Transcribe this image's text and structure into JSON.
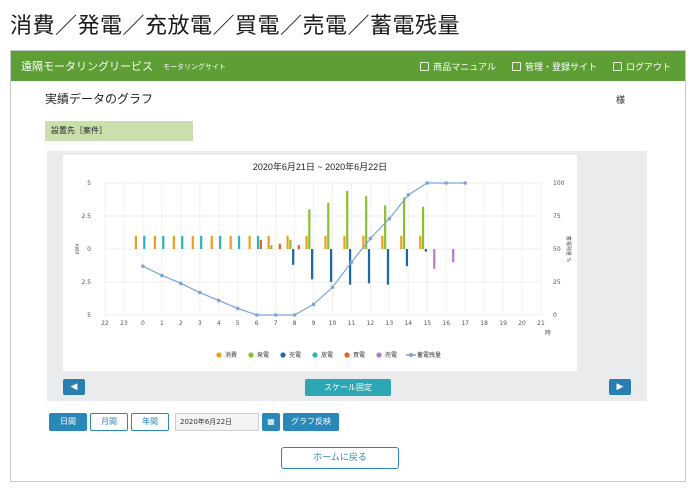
{
  "heading": "消費／発電／充放電／買電／売電／蓄電残量",
  "topbar": {
    "site_title": "遠隔モータリングリービス",
    "site_sub": "モータリングサイト",
    "nav": [
      "商品マニュアル",
      "管理・登録サイト",
      "ログアウト"
    ]
  },
  "section_title": "実績データのグラフ",
  "user_label": "様",
  "site_label": "設置先［案件］",
  "chart_data": {
    "type": "bar",
    "title": "2020年6月21日 ~ 2020年6月22日",
    "x": [
      "22",
      "23",
      "0",
      "1",
      "2",
      "3",
      "4",
      "5",
      "6",
      "7",
      "8",
      "9",
      "10",
      "11",
      "12",
      "13",
      "14",
      "15",
      "16",
      "17",
      "18",
      "19",
      "20",
      "21"
    ],
    "x_unit": "時",
    "y_left_ticks": [
      "5",
      "2.5",
      "0",
      "2.5",
      "5"
    ],
    "y_left_range": [
      -5,
      5
    ],
    "y_left_label": "kWh",
    "y_right_ticks": [
      "100",
      "75",
      "50",
      "25",
      "0"
    ],
    "y_right_range": [
      0,
      100
    ],
    "y_right_label": "蓄電残量 %",
    "series": [
      {
        "name": "消費",
        "color": "#e8a020",
        "values": [
          null,
          null,
          1,
          1,
          1,
          1,
          1,
          1,
          1,
          1,
          1,
          1,
          1,
          1,
          1,
          1,
          1,
          1,
          null,
          null,
          null,
          null,
          null,
          null
        ]
      },
      {
        "name": "発電",
        "color": "#8cbf2e",
        "values": [
          null,
          null,
          0,
          0,
          0,
          0,
          0,
          0,
          0,
          0.3,
          0.7,
          3,
          3.5,
          4.4,
          4,
          3.3,
          3.9,
          3.2,
          null,
          null,
          null,
          null,
          null,
          null
        ]
      },
      {
        "name": "充電",
        "color": "#1b6aa5",
        "values": [
          null,
          null,
          0,
          0,
          0,
          0,
          0,
          0,
          0,
          0,
          -1.2,
          -2.3,
          -2.5,
          -2.7,
          -2.6,
          -2.7,
          -1.3,
          -0.2,
          null,
          null,
          null,
          null,
          null,
          null
        ]
      },
      {
        "name": "放電",
        "color": "#2bb3b5",
        "values": [
          null,
          null,
          1,
          1,
          1,
          1,
          1,
          1,
          1,
          0,
          0,
          0,
          0,
          0,
          0,
          0,
          0,
          0,
          null,
          null,
          null,
          null,
          null,
          null
        ]
      },
      {
        "name": "買電",
        "color": "#e0602a",
        "values": [
          null,
          null,
          0,
          0,
          0,
          0,
          0,
          0,
          0.7,
          0.4,
          0.3,
          0,
          0,
          0,
          0,
          0,
          0,
          0,
          null,
          null,
          null,
          null,
          null,
          null
        ]
      },
      {
        "name": "売電",
        "color": "#b27cc6",
        "values": [
          null,
          null,
          0,
          0,
          0,
          0,
          0,
          0,
          0,
          0,
          0,
          0,
          0,
          0,
          0,
          0,
          0,
          -1.5,
          -1,
          null,
          null,
          null,
          null,
          null
        ]
      }
    ],
    "line_series": {
      "name": "蓄電残量",
      "color": "#7aa5d4",
      "values": [
        null,
        null,
        37,
        30,
        24,
        17,
        11,
        5,
        0,
        0,
        0,
        8,
        21,
        40,
        58,
        73,
        91,
        100,
        100,
        100,
        null,
        null,
        null,
        null
      ]
    },
    "legend": [
      "消費",
      "発電",
      "充電",
      "放電",
      "買電",
      "売電",
      "蓄電残量"
    ],
    "legend_position": "bottom"
  },
  "buttons": {
    "prev": "◀",
    "next": "▶",
    "scale": "スケール固定",
    "daily": "日間",
    "monthly": "月間",
    "yearly": "年間",
    "date_value": "2020年6月22日",
    "calendar": "▦",
    "reflect": "グラフ反映",
    "home": "ホームに戻る"
  }
}
